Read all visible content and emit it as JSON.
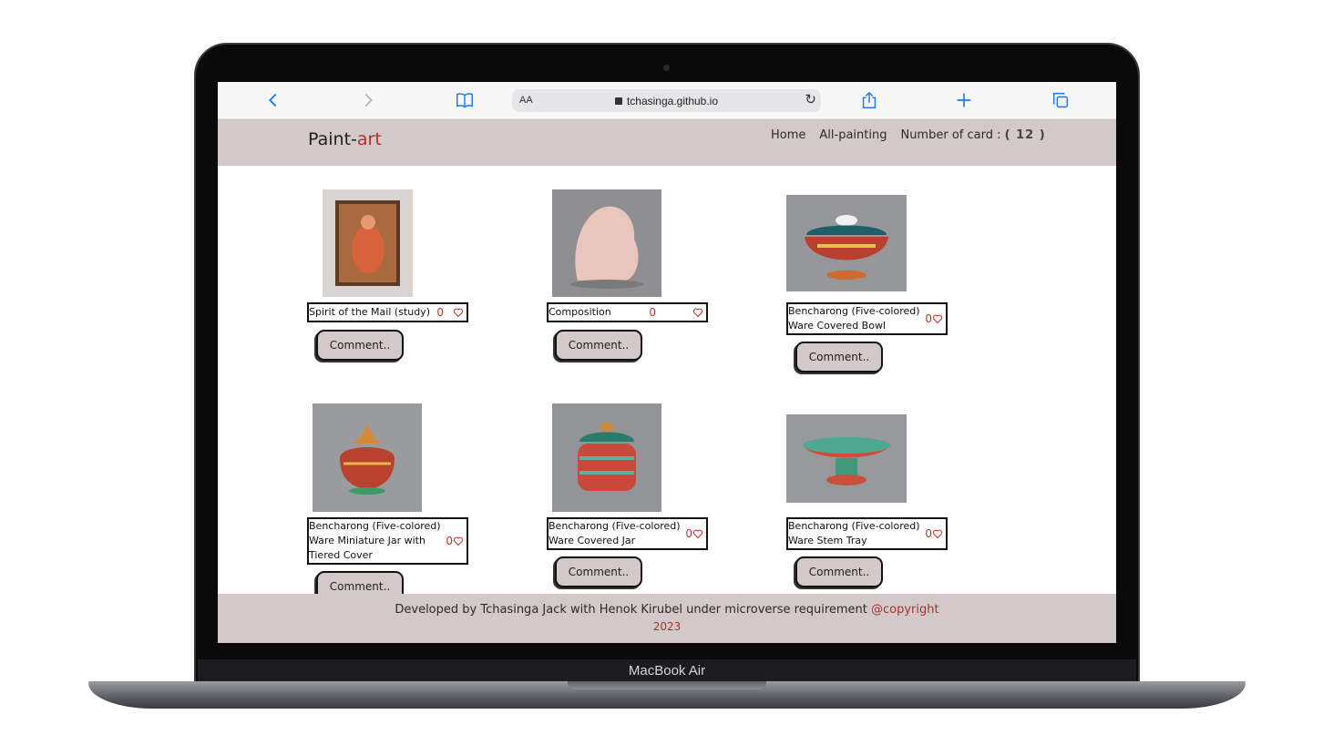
{
  "device": {
    "model_label": "MacBook Air"
  },
  "browser": {
    "aa_label": "AA",
    "url": "tchasinga.github.io"
  },
  "site": {
    "logo_main": "Paint-",
    "logo_accent": "art",
    "nav": {
      "home": "Home",
      "all_painting": "All-painting",
      "count_label": "Number of card :",
      "count_value": "( 12 )"
    }
  },
  "cards": [
    {
      "title": "Spirit of the Mail (study)",
      "likes": "0",
      "button": "Comment.."
    },
    {
      "title": "Composition",
      "likes": "0",
      "button": "Comment.."
    },
    {
      "title": "Bencharong (Five-colored) Ware Covered Bowl",
      "likes": "0",
      "button": "Comment.."
    },
    {
      "title": "Bencharong (Five-colored) Ware Miniature Jar with Tiered Cover",
      "likes": "0",
      "button": "Comment.."
    },
    {
      "title": "Bencharong (Five-colored) Ware Covered Jar",
      "likes": "0",
      "button": "Comment.."
    },
    {
      "title": "Bencharong (Five-colored) Ware Stem Tray",
      "likes": "0",
      "button": "Comment.."
    }
  ],
  "footer": {
    "text": "Developed by Tchasinga Jack with Henok Kirubel under microverse requirement ",
    "copyright": "@copyright",
    "year": "2023"
  },
  "colors": {
    "header_bg": "#d4c9c9",
    "accent": "#a9322f",
    "browser_blue": "#1a7cf5"
  }
}
